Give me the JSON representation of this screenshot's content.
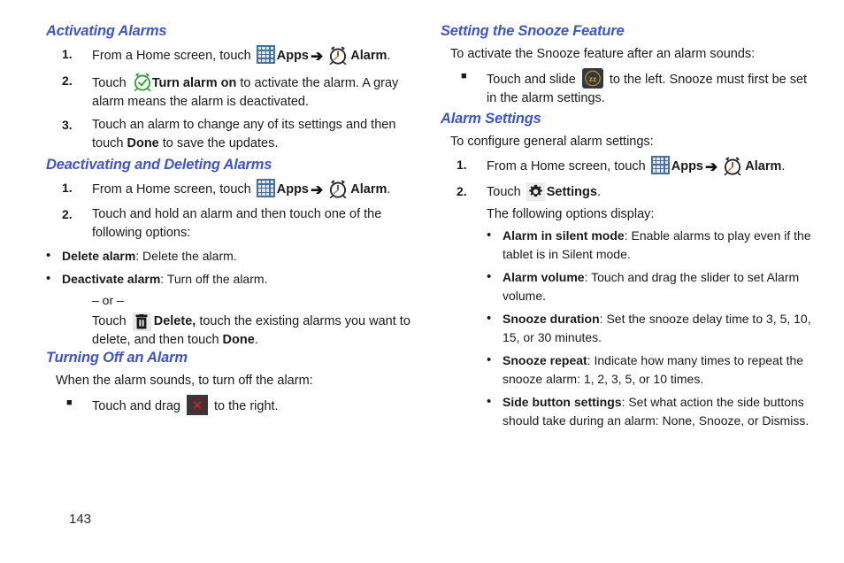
{
  "page": {
    "number": "143",
    "heading_color": "#3f56c2"
  },
  "icons": {
    "apps": "apps-grid-icon",
    "arrow": "➔",
    "alarm_clock": "alarm-clock-icon",
    "alarm_on": "alarm-clock-green-check-icon",
    "delete": "trash-can-icon",
    "settings": "gear-icon",
    "dismiss": "red-x-dismiss-icon",
    "snooze": "snooze-zz-icon",
    "square_bullet": "■",
    "dot_bullet": "•"
  },
  "left": {
    "activating": {
      "heading": "Activating Alarms",
      "steps": [
        {
          "num": "1.",
          "parts": [
            {
              "t": "From a Home screen, touch ",
              "b": false
            },
            {
              "icon": "apps"
            },
            {
              "t": "Apps",
              "b": true
            },
            {
              "icon": "arrow"
            },
            {
              "icon": "alarm_clock"
            },
            {
              "t": "Alarm",
              "b": true
            },
            {
              "t": ".",
              "b": false
            }
          ]
        },
        {
          "num": "2.",
          "parts": [
            {
              "t": "Touch ",
              "b": false
            },
            {
              "icon": "alarm_on"
            },
            {
              "t": "Turn alarm on",
              "b": true
            },
            {
              "t": " to activate the alarm. A gray alarm means the alarm is deactivated.",
              "b": false
            }
          ]
        },
        {
          "num": "3.",
          "parts": [
            {
              "t": "Touch an alarm to change any of its settings and then touch ",
              "b": false
            },
            {
              "t": "Done",
              "b": true
            },
            {
              "t": " to save the updates.",
              "b": false
            }
          ]
        }
      ]
    },
    "deactivating": {
      "heading": "Deactivating and Deleting Alarms",
      "steps": [
        {
          "num": "1.",
          "parts": [
            {
              "t": "From a Home screen, touch ",
              "b": false
            },
            {
              "icon": "apps"
            },
            {
              "t": "Apps",
              "b": true
            },
            {
              "icon": "arrow"
            },
            {
              "icon": "alarm_clock"
            },
            {
              "t": "Alarm",
              "b": true
            },
            {
              "t": ".",
              "b": false
            }
          ]
        },
        {
          "num": "2.",
          "parts": [
            {
              "t": "Touch and hold an alarm and then touch one of the following options:",
              "b": false
            }
          ]
        }
      ],
      "options": [
        {
          "label": "Delete alarm",
          "desc": ": Delete the alarm."
        },
        {
          "label": "Deactivate alarm",
          "desc": ": Turn off the alarm."
        }
      ],
      "or_text": "– or –",
      "or_parts": [
        {
          "t": "Touch ",
          "b": false
        },
        {
          "icon": "delete"
        },
        {
          "t": "Delete,",
          "b": true
        },
        {
          "t": " touch the existing alarms you want to delete, and then touch ",
          "b": false
        },
        {
          "t": "Done",
          "b": true
        },
        {
          "t": ".",
          "b": false
        }
      ]
    },
    "turning_off": {
      "heading": "Turning Off an Alarm",
      "lead": "When the alarm sounds, to turn off the alarm:",
      "bullets": [
        {
          "parts": [
            {
              "t": "Touch and drag ",
              "b": false
            },
            {
              "icon": "dismiss"
            },
            {
              "t": " to the right.",
              "b": false
            }
          ]
        }
      ]
    }
  },
  "right": {
    "snooze": {
      "heading": "Setting the Snooze Feature",
      "lead": "To activate the Snooze feature after an alarm sounds:",
      "bullets": [
        {
          "parts": [
            {
              "t": "Touch and slide ",
              "b": false
            },
            {
              "icon": "snooze"
            },
            {
              "t": " to the left. Snooze must first be set in the alarm settings.",
              "b": false
            }
          ]
        }
      ]
    },
    "settings": {
      "heading": "Alarm Settings",
      "lead": "To configure general alarm settings:",
      "steps": [
        {
          "num": "1.",
          "parts": [
            {
              "t": "From a Home screen, touch ",
              "b": false
            },
            {
              "icon": "apps"
            },
            {
              "t": "Apps",
              "b": true
            },
            {
              "icon": "arrow"
            },
            {
              "icon": "alarm_clock"
            },
            {
              "t": "Alarm",
              "b": true
            },
            {
              "t": ".",
              "b": false
            }
          ]
        },
        {
          "num": "2.",
          "parts": [
            {
              "t": "Touch ",
              "b": false
            },
            {
              "icon": "settings"
            },
            {
              "t": "Settings",
              "b": true
            },
            {
              "t": ".",
              "b": false
            }
          ]
        }
      ],
      "sub_lead": "The following options display:",
      "options": [
        {
          "label": "Alarm in silent mode",
          "desc": ": Enable alarms to play even if the tablet is in Silent mode."
        },
        {
          "label": "Alarm volume",
          "desc": ": Touch and drag the slider to set Alarm volume."
        },
        {
          "label": "Snooze duration",
          "desc": ": Set the snooze delay time to 3, 5, 10, 15, or 30 minutes."
        },
        {
          "label": "Snooze repeat",
          "desc": ": Indicate how many times to repeat the snooze alarm: 1, 2, 3, 5, or 10 times."
        },
        {
          "label": "Side button settings",
          "desc": ": Set what action the side buttons should take during an alarm: None, Snooze, or Dismiss."
        }
      ]
    }
  }
}
